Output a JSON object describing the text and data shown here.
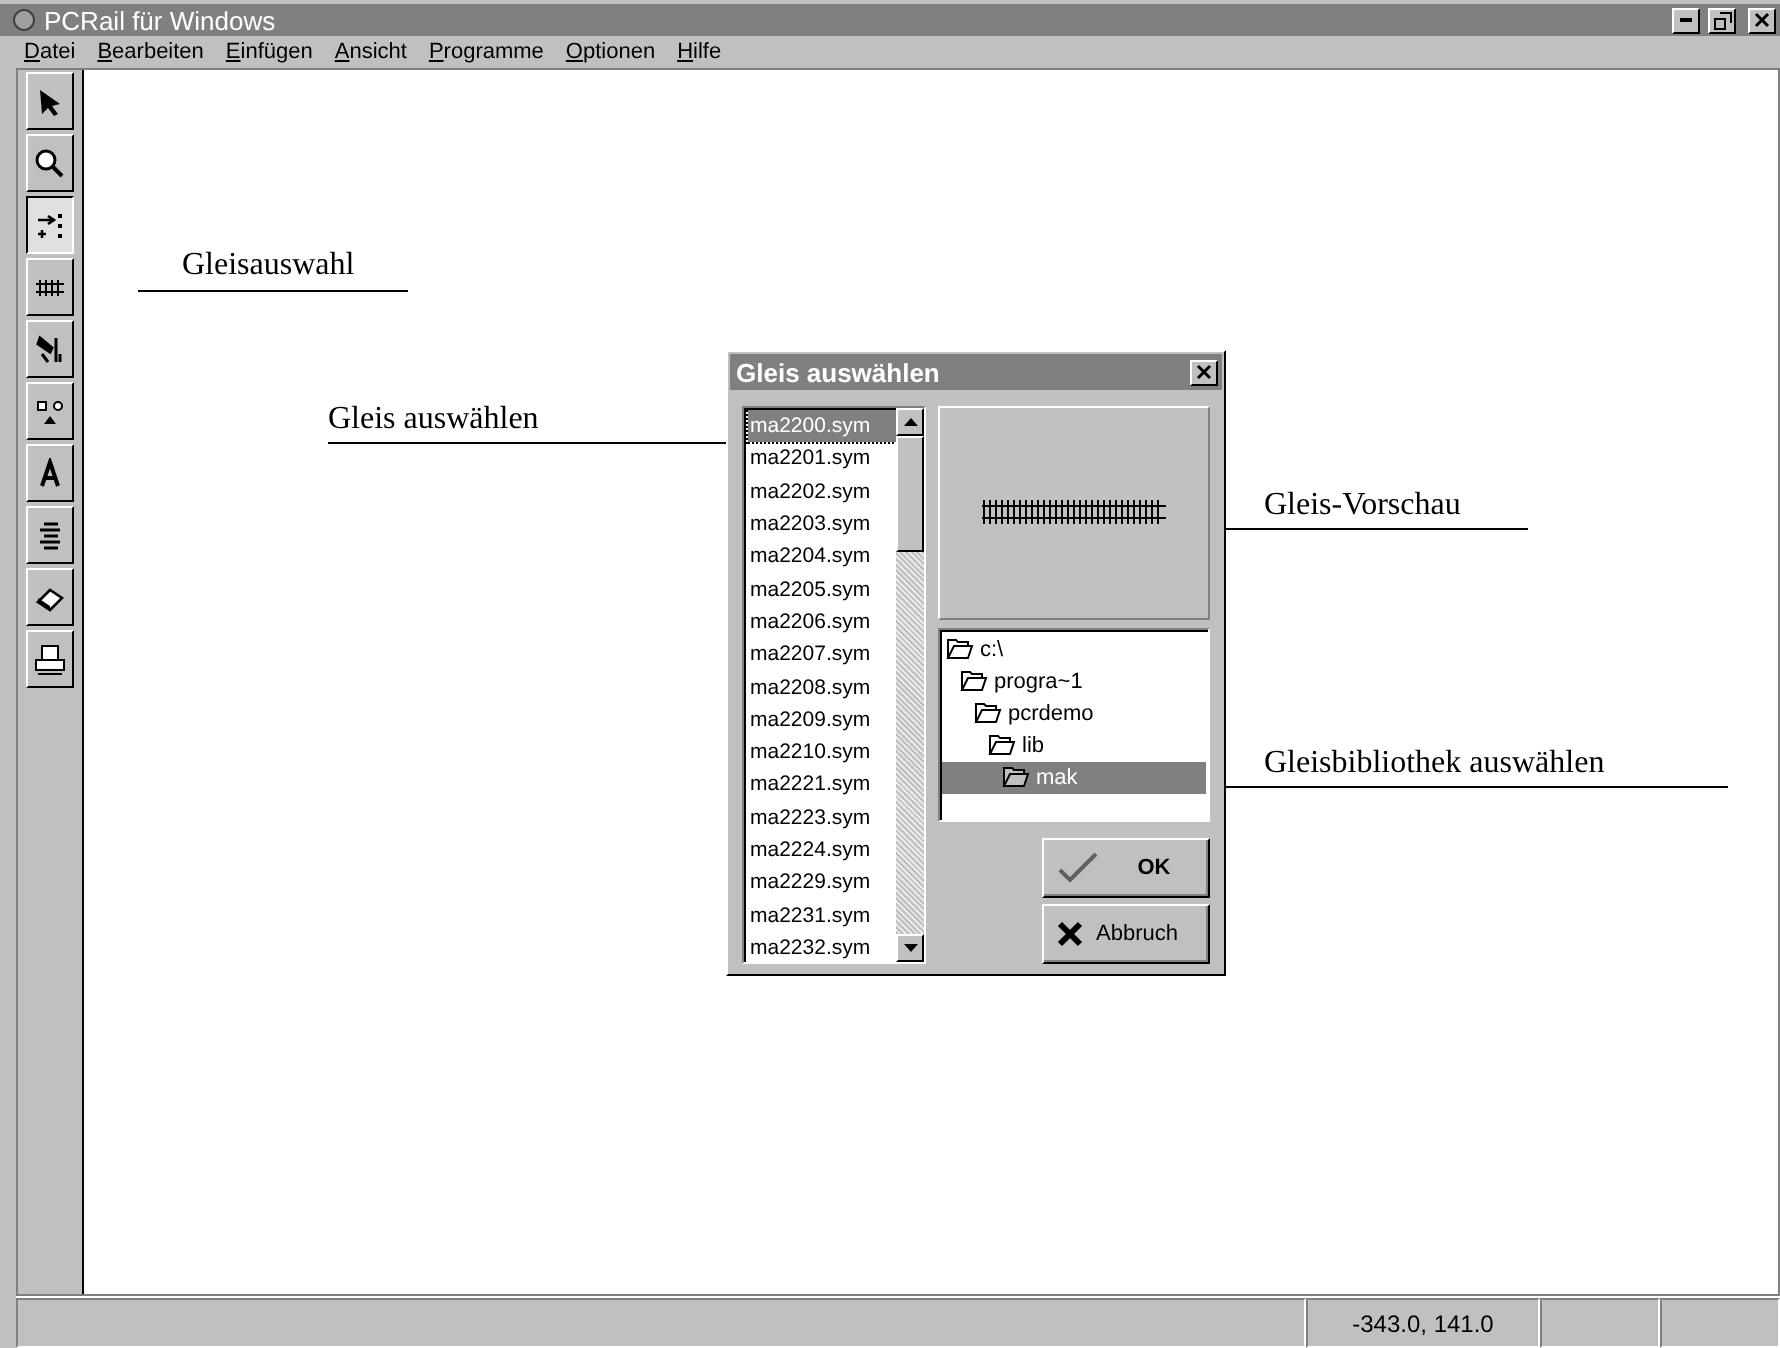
{
  "window": {
    "title": "PCRail für Windows"
  },
  "menu": [
    "Datei",
    "Bearbeiten",
    "Einfügen",
    "Ansicht",
    "Programme",
    "Optionen",
    "Hilfe"
  ],
  "tools": [
    {
      "kind": "arrow",
      "selected": false
    },
    {
      "kind": "zoom",
      "selected": false
    },
    {
      "kind": "track-select",
      "selected": true
    },
    {
      "kind": "track",
      "selected": false
    },
    {
      "kind": "tools",
      "selected": false
    },
    {
      "kind": "shapes",
      "selected": false
    },
    {
      "kind": "text",
      "selected": false
    },
    {
      "kind": "align",
      "selected": false
    },
    {
      "kind": "eraser",
      "selected": false
    },
    {
      "kind": "print",
      "selected": false
    }
  ],
  "dialog": {
    "title": "Gleis auswählen",
    "files": [
      {
        "name": "ma2200.sym",
        "selected": true
      },
      {
        "name": "ma2201.sym",
        "selected": false
      },
      {
        "name": "ma2202.sym",
        "selected": false
      },
      {
        "name": "ma2203.sym",
        "selected": false
      },
      {
        "name": "ma2204.sym",
        "selected": false
      },
      {
        "name": "ma2205.sym",
        "selected": false
      },
      {
        "name": "ma2206.sym",
        "selected": false
      },
      {
        "name": "ma2207.sym",
        "selected": false
      },
      {
        "name": "ma2208.sym",
        "selected": false
      },
      {
        "name": "ma2209.sym",
        "selected": false
      },
      {
        "name": "ma2210.sym",
        "selected": false
      },
      {
        "name": "ma2221.sym",
        "selected": false
      },
      {
        "name": "ma2223.sym",
        "selected": false
      },
      {
        "name": "ma2224.sym",
        "selected": false
      },
      {
        "name": "ma2229.sym",
        "selected": false
      },
      {
        "name": "ma2231.sym",
        "selected": false
      },
      {
        "name": "ma2232.sym",
        "selected": false
      }
    ],
    "tree": [
      {
        "label": "c:\\",
        "selected": false,
        "children": [
          {
            "label": "progra~1",
            "selected": false,
            "children": [
              {
                "label": "pcrdemo",
                "selected": false,
                "children": [
                  {
                    "label": "lib",
                    "selected": false,
                    "children": [
                      {
                        "label": "mak",
                        "selected": true
                      }
                    ]
                  }
                ]
              }
            ]
          }
        ]
      }
    ],
    "buttons": [
      {
        "kind": "ok",
        "label": "OK"
      },
      {
        "kind": "cancel",
        "label": "Abbruch"
      }
    ]
  },
  "annotations": [
    {
      "text": "Gleisauswahl"
    },
    {
      "text": "Gleis auswählen"
    },
    {
      "text": "Gleis-Vorschau"
    },
    {
      "text": "Gleisbibliothek auswählen"
    }
  ],
  "status_bar": [
    "-343.0, 141.0"
  ]
}
